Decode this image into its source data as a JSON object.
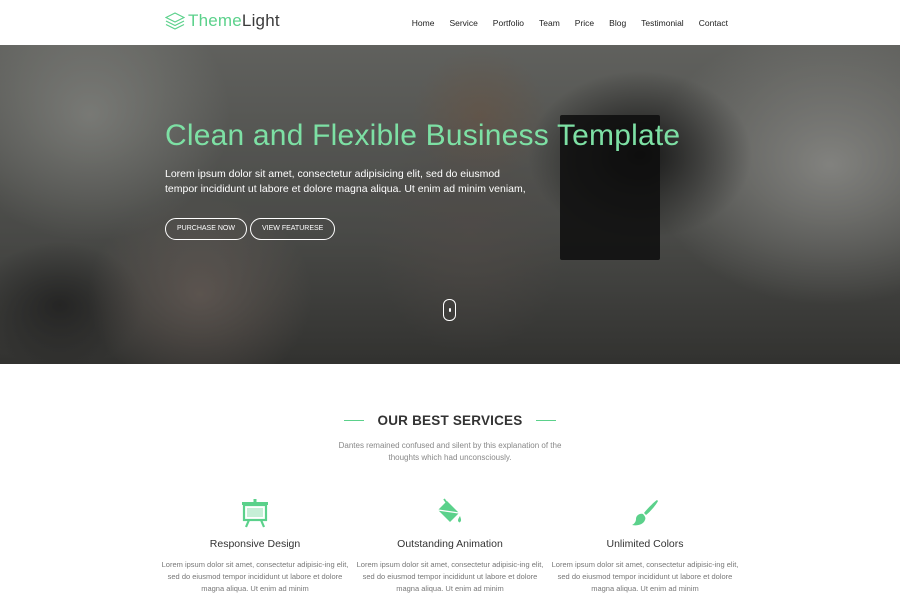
{
  "brand": {
    "logo_light": "Theme",
    "logo_strong": "Light",
    "icon": "layers-logo-icon"
  },
  "nav": {
    "items": [
      {
        "label": "Home"
      },
      {
        "label": "Service"
      },
      {
        "label": "Portfolio"
      },
      {
        "label": "Team"
      },
      {
        "label": "Price"
      },
      {
        "label": "Blog"
      },
      {
        "label": "Testimonial"
      },
      {
        "label": "Contact"
      }
    ]
  },
  "hero": {
    "title": "Clean and Flexible Business Template",
    "text_line1": "Lorem ipsum dolor sit amet, consectetur adipisicing elit, sed do eiusmod",
    "text_line2": "tempor incididunt ut labore et dolore magna aliqua. Ut enim ad minim veniam,",
    "purchase_label": "PURCHASE NOW",
    "features_label": "VIEW FEATURESE",
    "scroll_icon": "mouse-scroll-icon"
  },
  "services": {
    "heading": "OUR BEST SERVICES",
    "subtitle": "Dantes remained confused and silent by this explanation of the thoughts which had unconsciously.",
    "items": [
      {
        "icon": "presentation-board-icon",
        "title": "Responsive Design",
        "text": "Lorem ipsum dolor sit amet, consectetur adipisic-ing elit, sed do eiusmod tempor incididunt ut labore et dolore magna aliqua. Ut enim ad minim"
      },
      {
        "icon": "paint-bucket-icon",
        "title": "Outstanding Animation",
        "text": "Lorem ipsum dolor sit amet, consectetur adipisic-ing elit, sed do eiusmod tempor incididunt ut labore et dolore magna aliqua. Ut enim ad minim"
      },
      {
        "icon": "paint-brush-icon",
        "title": "Unlimited Colors",
        "text": "Lorem ipsum dolor sit amet, consectetur adipisic-ing elit, sed do eiusmod tempor incididunt ut labore et dolore magna aliqua. Ut enim ad minim"
      }
    ]
  },
  "colors": {
    "accent": "#5bd18b",
    "hero_title": "#7de0a4",
    "text_dark": "#333333",
    "text_muted": "#777777"
  }
}
